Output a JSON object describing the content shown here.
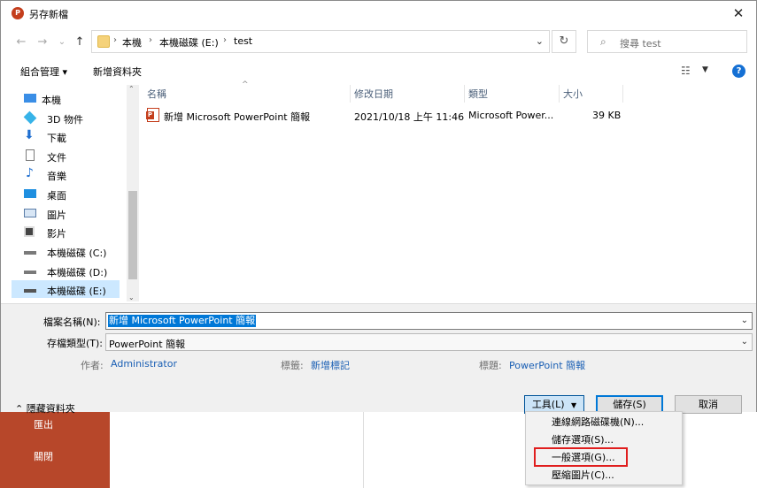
{
  "background_app": {
    "items": [
      "匯出",
      "關閉"
    ]
  },
  "titlebar": {
    "title": "另存新檔",
    "app_icon": "P",
    "close_glyph": "✕"
  },
  "navigation": {
    "back_glyph": "←",
    "forward_glyph": "→",
    "recent_glyph": "⌄",
    "up_glyph": "↑"
  },
  "address": {
    "crumbs": [
      "本機",
      "本機磁碟 (E:)",
      "test"
    ],
    "refresh_glyph": "↻"
  },
  "search": {
    "placeholder": "搜尋 test"
  },
  "toolbar": {
    "organize_label": "組合管理 ▾",
    "new_folder_label": "新增資料夾",
    "help_glyph": "?"
  },
  "sidebar": {
    "items": [
      {
        "label": "本機",
        "icon": "computer-icon"
      },
      {
        "label": "3D 物件",
        "icon": "3d-objects-icon"
      },
      {
        "label": "下載",
        "icon": "download-icon"
      },
      {
        "label": "文件",
        "icon": "document-icon"
      },
      {
        "label": "音樂",
        "icon": "music-icon"
      },
      {
        "label": "桌面",
        "icon": "desktop-icon"
      },
      {
        "label": "圖片",
        "icon": "pictures-icon"
      },
      {
        "label": "影片",
        "icon": "videos-icon"
      },
      {
        "label": "本機磁碟 (C:)",
        "icon": "drive-icon"
      },
      {
        "label": "本機磁碟 (D:)",
        "icon": "drive-icon"
      },
      {
        "label": "本機磁碟 (E:)",
        "icon": "drive-icon",
        "selected": true
      }
    ]
  },
  "file_list": {
    "columns": [
      "名稱",
      "修改日期",
      "類型",
      "大小"
    ],
    "rows": [
      {
        "name": "新增 Microsoft PowerPoint 簡報",
        "modified": "2021/10/18 上午 11:46",
        "type": "Microsoft Power...",
        "size": "39 KB"
      }
    ]
  },
  "form": {
    "filename_label": "檔案名稱(N):",
    "filename_value": "新增 Microsoft PowerPoint 簡報",
    "filetype_label": "存檔類型(T):",
    "filetype_value": "PowerPoint 簡報",
    "author_label": "作者:",
    "author_value": "Administrator",
    "tags_label": "標籤:",
    "tags_value": "新增標記",
    "subject_label": "標題:",
    "subject_value": "PowerPoint 簡報"
  },
  "footer": {
    "hide_folders_label": "隱藏資料夾",
    "tools_label": "工具(L)",
    "save_label": "儲存(S)",
    "cancel_label": "取消"
  },
  "tools_menu": {
    "items": [
      "連線網路磁碟機(N)...",
      "儲存選項(S)...",
      "一般選項(G)...",
      "壓縮圖片(C)..."
    ],
    "highlighted_index": 2
  },
  "colors": {
    "accent": "#0078d7",
    "selection": "#cce8ff",
    "ppt_red": "#c43e1c",
    "highlight_border": "#e01e1e"
  }
}
